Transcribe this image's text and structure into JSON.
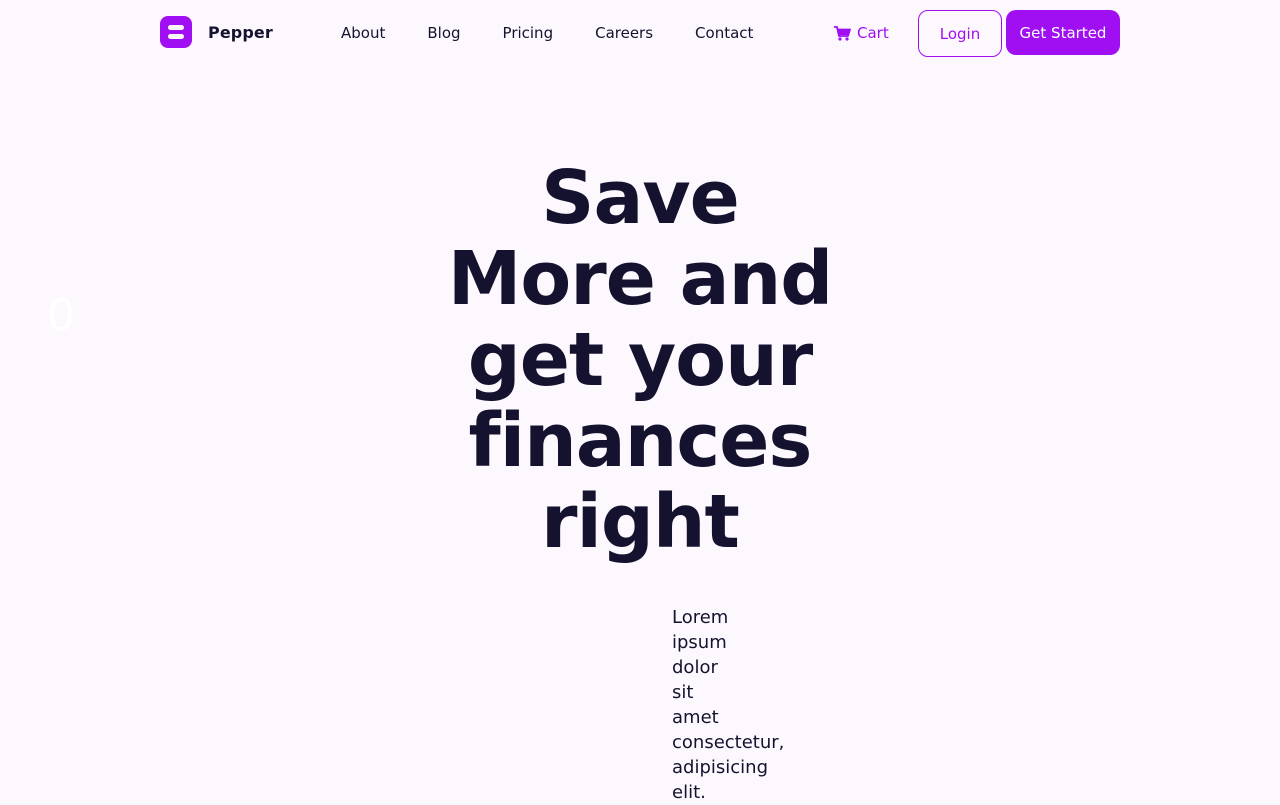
{
  "brand": {
    "name": "Pepper",
    "logo_icon": "pepper-logo-icon",
    "accent": "#a00ef2",
    "background": "#fdf8fd",
    "text": "#14122e"
  },
  "nav": {
    "items": [
      {
        "label": "About"
      },
      {
        "label": "Blog"
      },
      {
        "label": "Pricing"
      },
      {
        "label": "Careers"
      },
      {
        "label": "Contact"
      }
    ]
  },
  "header_actions": {
    "cart_label": "Cart",
    "cart_icon": "cart-icon",
    "login_label": "Login",
    "get_started_label": "Get Started"
  },
  "hero": {
    "counter": "0",
    "title_lines": [
      "Save",
      "More and",
      "get your",
      "finances",
      "right"
    ],
    "subtitle_words": [
      "Lorem",
      "ipsum",
      "dolor",
      "sit",
      "amet",
      "consectetur,",
      "adipisicing",
      "elit."
    ]
  }
}
